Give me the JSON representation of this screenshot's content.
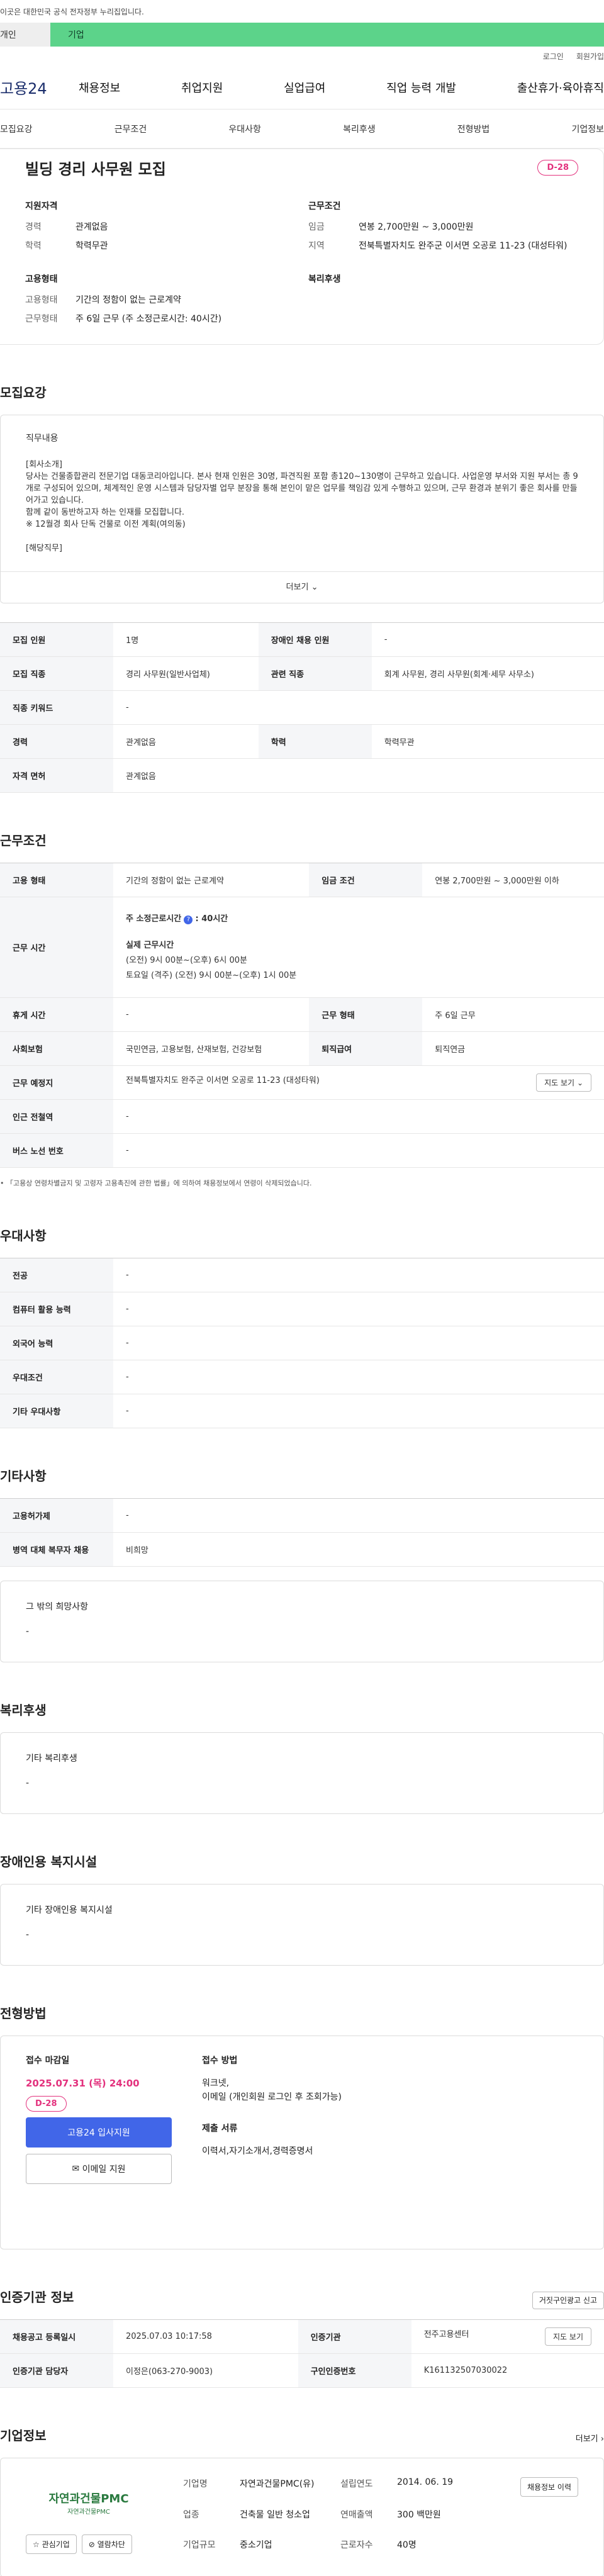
{
  "notice": "이곳은 대한민국 공식 전자정부 누리집입니다.",
  "top_tabs": {
    "left": "개인",
    "right": "기업"
  },
  "util": {
    "login": "로그인",
    "signup": "회원가입"
  },
  "logo": "고용24",
  "gnb": [
    "채용정보",
    "취업지원",
    "실업급여",
    "직업 능력 개발",
    "출산휴가·육아휴직"
  ],
  "anchors": [
    "모집요강",
    "근무조건",
    "우대사항",
    "복리후생",
    "전형방법",
    "기업정보"
  ],
  "summary": {
    "title": "빌딩 경리 사무원 모집",
    "dday": "D-28",
    "qual": {
      "heading": "지원자격",
      "exp_k": "경력",
      "exp_v": "관계없음",
      "edu_k": "학력",
      "edu_v": "학력무관"
    },
    "work": {
      "heading": "근무조건",
      "pay_k": "임금",
      "pay_v": "연봉 2,700만원 ~ 3,000만원",
      "loc_k": "지역",
      "loc_v": "전북특별자치도 완주군 이서면 오공로 11-23 (대성타워)"
    },
    "emp": {
      "heading": "고용형태",
      "type_k": "고용형태",
      "type_v": "기간의 정함이 없는 근로계약",
      "hours_k": "근무형태",
      "hours_v": "주 6일 근무 (주 소정근로시간: 40시간)"
    },
    "welfare_heading": "복리후생"
  },
  "recruit": {
    "heading": "모집요강",
    "box_title": "직무내용",
    "lines": [
      "[회사소개]",
      "당사는 건물종합관리 전문기업 대동코리아입니다. 본사 현재 인원은 30명, 파견직원 포함 총120~130명이 근무하고 있습니다. 사업운영 부서와 지원 부서는 총 9개로 구성되어 있으며, 체계적인 운영 시스템과 담당자별 업무 분장을 통해 본인이 맡은 업무를 책임감 있게 수행하고 있으며, 근무 환경과 분위기 좋은 회사를 만들어가고 있습니다.",
      "함께 같이 동반하고자 하는 인재를 모집합니다.",
      "※ 12월경 회사 단독 건물로 이전 계획(여의동)",
      "",
      "[해당직무]"
    ],
    "more": "더보기",
    "table": [
      [
        "모집 인원",
        "1명",
        "장애인 채용 인원",
        "-"
      ],
      [
        "모집 직종",
        "경리 사무원(일반사업체)",
        "관련 직종",
        "회계 사무원, 경리 사무원(회계·세무 사무소)"
      ],
      [
        "직종 키워드",
        "-",
        "",
        ""
      ],
      [
        "경력",
        "관계없음",
        "학력",
        "학력무관"
      ],
      [
        "자격 면허",
        "관계없음",
        "",
        ""
      ]
    ]
  },
  "conditions": {
    "heading": "근무조건",
    "emp_k": "고용 형태",
    "emp_v": "기간의 정함이 없는 근로계약",
    "pay_k": "임금 조건",
    "pay_v": "연봉 2,700만원 ~ 3,000만원 이하",
    "time_k": "근무 시간",
    "time_head": "주 소정근로시간",
    "time_head_val": ": 40시간",
    "real_head": "실제 근무시간",
    "real_l1": "(오전) 9시 00분~(오후) 6시 00분",
    "real_l2": "토요일 (격주) (오전) 9시 00분~(오후) 1시 00분",
    "rest_k": "휴게 시간",
    "rest_v": "-",
    "form_k": "근무 형태",
    "form_v": "주 6일 근무",
    "ins_k": "사회보험",
    "ins_v": "국민연금, 고용보험, 산재보험, 건강보험",
    "ret_k": "퇴직급여",
    "ret_v": "퇴직연금",
    "place_k": "근무 예정지",
    "place_v": "전북특별자치도 완주군 이서면 오공로 11-23 (대성타워)",
    "map_btn": "지도 보기",
    "metro_k": "인근 전철역",
    "metro_v": "-",
    "bus_k": "버스 노선 번호",
    "bus_v": "-",
    "note": "「고용상 연령차별금지 및 고령자 고용촉진에 관한 법률」에 의하여 채용정보에서 연령이 삭제되었습니다."
  },
  "prefer": {
    "heading": "우대사항",
    "rows": [
      [
        "전공",
        "-"
      ],
      [
        "컴퓨터 활용 능력",
        "-"
      ],
      [
        "외국어 능력",
        "-"
      ],
      [
        "우대조건",
        "-"
      ],
      [
        "기타 우대사항",
        "-"
      ]
    ]
  },
  "etc": {
    "heading": "기타사항",
    "rows": [
      [
        "고용허가제",
        "-"
      ],
      [
        "병역 대체 복무자 채용",
        "비희망"
      ]
    ],
    "box_title": "그 밖의 희망사항",
    "box_val": "-"
  },
  "welfare": {
    "heading": "복리후생",
    "box_title": "기타 복리후생",
    "box_val": "-"
  },
  "disabled": {
    "heading": "장애인용 복지시설",
    "box_title": "기타 장애인용 복지시설",
    "box_val": "-"
  },
  "selection": {
    "heading": "전형방법",
    "deadline_title": "접수 마감일",
    "deadline": "2025.07.31 (목) 24:00",
    "dday": "D-28",
    "btn1": "고용24 입사지원",
    "btn2": "이메일 지원",
    "method_title": "접수 방법",
    "method_l1": "워크넷,",
    "method_l2": "이메일 (개인회원 로그인 후 조회가능)",
    "doc_title": "제출 서류",
    "doc_v": "이력서,자기소개서,경력증명서"
  },
  "agency": {
    "heading": "인증기관 정보",
    "report_btn": "거짓구인광고 신고",
    "row1": [
      "채용공고 등록일시",
      "2025.07.03 10:17:58",
      "인증기관",
      "전주고용센터"
    ],
    "row2": [
      "인증기관 담당자",
      "이정은(063-270-9003)",
      "구인인증번호",
      "K161132507030022"
    ],
    "map_btn": "지도 보기"
  },
  "company": {
    "heading": "기업정보",
    "more": "더보기",
    "logo_text": "자연과건물PMC",
    "logo_sub": "자연과건물PMC",
    "fav": "관심기업",
    "block": "열람차단",
    "name_k": "기업명",
    "name_v": "자연과건물PMC(유)",
    "founded_k": "설립연도",
    "founded_v": "2014. 06. 19",
    "sector_k": "업종",
    "sector_v": "건축물 일반 청소업",
    "sales_k": "연매출액",
    "sales_v": "300 백만원",
    "emp_k": "근로자수",
    "emp_v": "40명",
    "size_k": "기업규모",
    "size_v": "중소기업",
    "history_btn": "채용정보 이력"
  },
  "colors": {
    "accent": "#4166e8",
    "dday": "#e3317d",
    "green": "#5cd38a"
  }
}
